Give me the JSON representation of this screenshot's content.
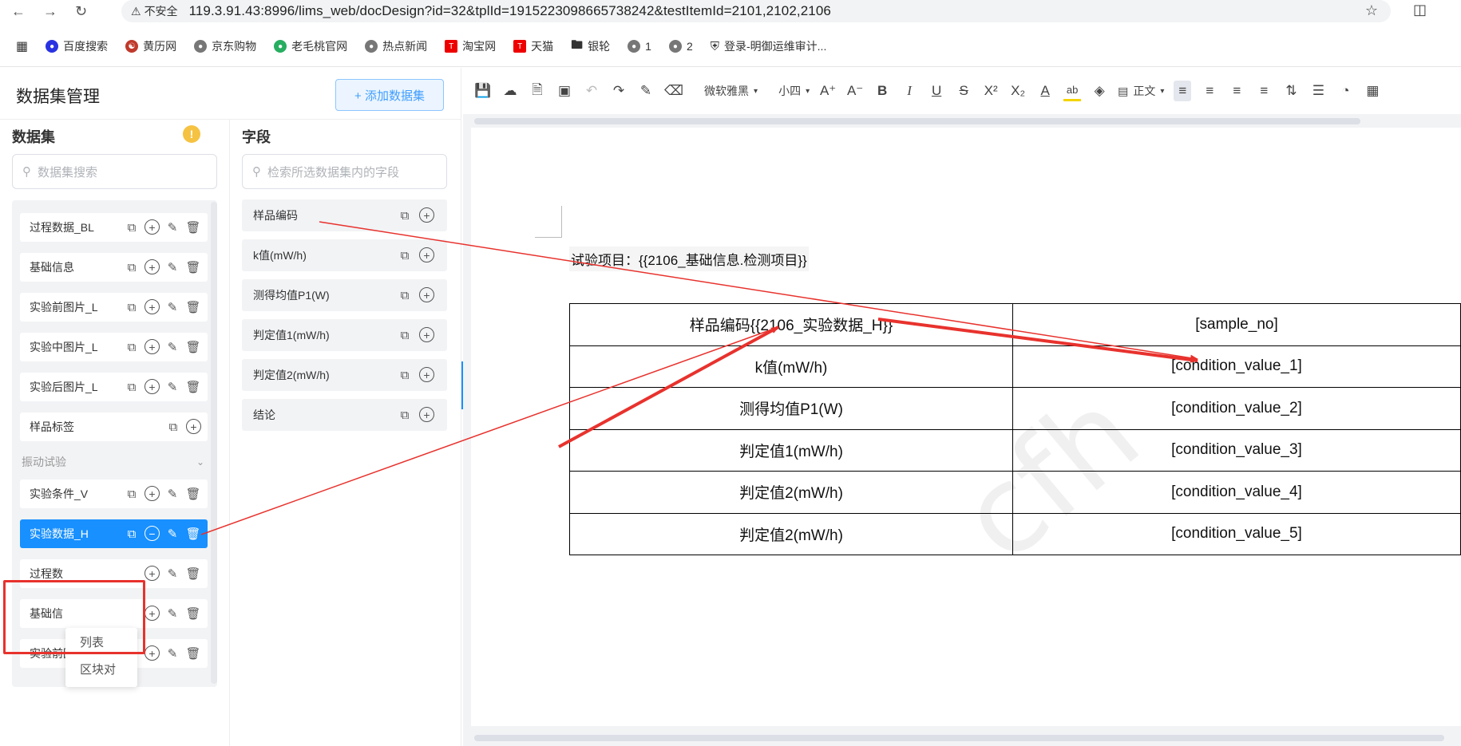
{
  "browser": {
    "not_secure_label": "不安全",
    "url": "119.3.91.43:8996/lims_web/docDesign?id=32&tplId=1915223098665738242&testItemId=2101,2102,2106",
    "bookmarks": [
      "百度搜索",
      "黄历网",
      "京东购物",
      "老毛桃官网",
      "热点新闻",
      "淘宝网",
      "天猫",
      "银轮",
      "1",
      "2",
      "登录-明御运维审计..."
    ]
  },
  "left_panel": {
    "title": "数据集管理",
    "add_button": "+ 添加数据集",
    "dataset_heading": "数据集",
    "dataset_search_placeholder": "数据集搜索",
    "field_heading": "字段",
    "field_search_placeholder": "检索所选数据集内的字段",
    "datasets_top": [
      "过程数据_BL",
      "基础信息",
      "实验前图片_L",
      "实验中图片_L",
      "实验后图片_L",
      "样品标签"
    ],
    "group_label": "振动试验",
    "datasets_group": [
      "实验条件_V",
      "实验数据_H",
      "过程数",
      "基础信",
      "实验前图片_L"
    ],
    "popup_items": [
      "列表",
      "区块对"
    ],
    "fields": [
      "样品编码",
      "k值(mW/h)",
      "测得均值P1(W)",
      "判定值1(mW/h)",
      "判定值2(mW/h)",
      "结论"
    ]
  },
  "toolbar": {
    "font_family": "微软雅黑",
    "font_size": "小四",
    "paragraph_style": "正文"
  },
  "document": {
    "test_item_line": "试验项目：{{2106_基础信息.检测项目}}",
    "table": [
      [
        "样品编码{{2106_实验数据_H}}",
        "[sample_no]"
      ],
      [
        "k值(mW/h)",
        "[condition_value_1]"
      ],
      [
        "测得均值P1(W)",
        "[condition_value_2]"
      ],
      [
        "判定值1(mW/h)",
        "[condition_value_3]"
      ],
      [
        "判定值2(mW/h)",
        "[condition_value_4]"
      ],
      [
        "判定值2(mW/h)",
        "[condition_value_5]"
      ]
    ],
    "watermark": "cfh"
  },
  "colors": {
    "accent": "#1890ff",
    "annotation_red": "#e8322d"
  }
}
